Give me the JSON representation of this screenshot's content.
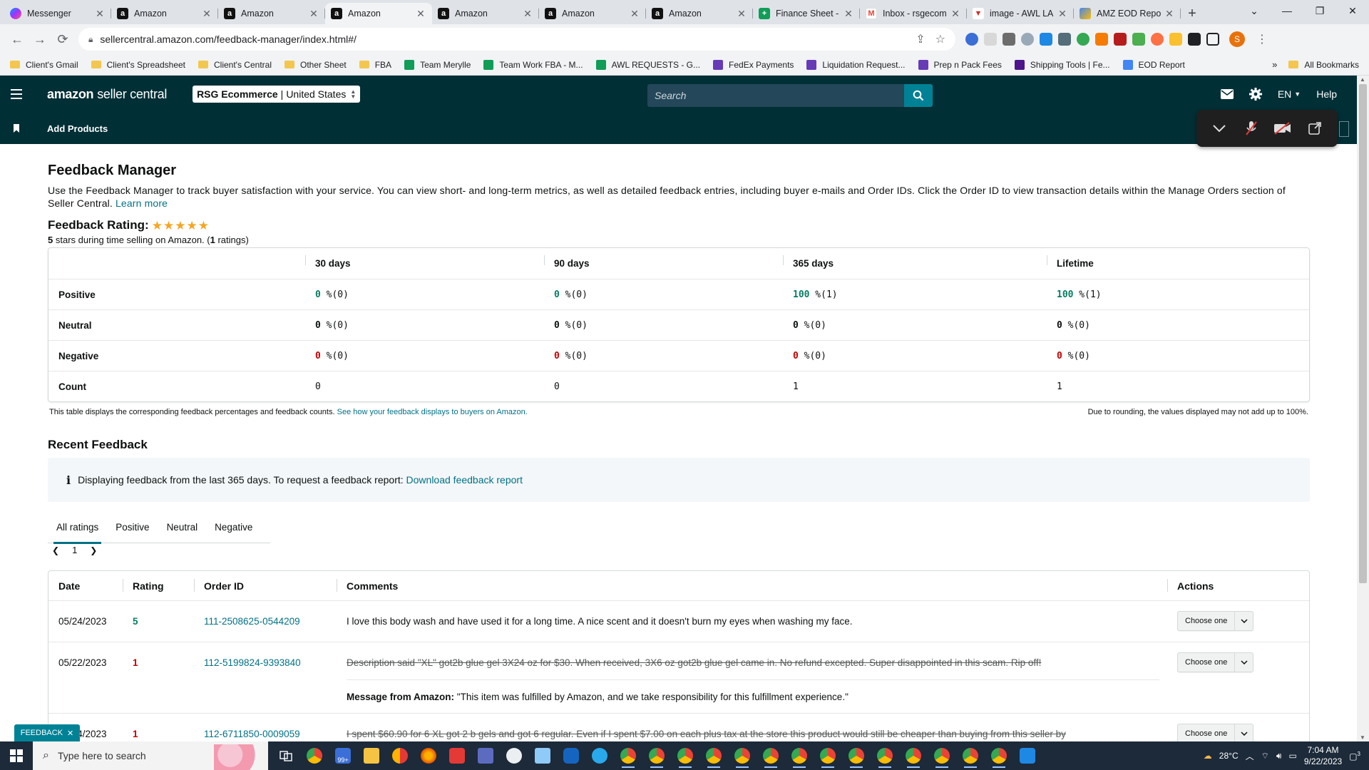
{
  "browser": {
    "tabs": [
      {
        "title": "Messenger",
        "fav": "msg"
      },
      {
        "title": "Amazon",
        "fav": "amz"
      },
      {
        "title": "Amazon",
        "fav": "amz"
      },
      {
        "title": "Amazon",
        "fav": "amz",
        "active": true
      },
      {
        "title": "Amazon",
        "fav": "amz"
      },
      {
        "title": "Amazon",
        "fav": "amz"
      },
      {
        "title": "Amazon",
        "fav": "amz"
      },
      {
        "title": "Finance Sheet -",
        "fav": "sheet"
      },
      {
        "title": "Inbox - rsgecom",
        "fav": "gmail"
      },
      {
        "title": "image - AWL LA",
        "fav": "img"
      },
      {
        "title": "AMZ EOD Repo",
        "fav": "eod"
      }
    ],
    "new_tab": "+",
    "url": "sellercentral.amazon.com/feedback-manager/index.html#/",
    "profile_initial": "S",
    "bookmarks": [
      {
        "label": "Client's Gmail",
        "kind": "folder"
      },
      {
        "label": "Client's Spreadsheet",
        "kind": "folder"
      },
      {
        "label": "Client's Central",
        "kind": "folder"
      },
      {
        "label": "Other Sheet",
        "kind": "folder"
      },
      {
        "label": "FBA",
        "kind": "folder"
      },
      {
        "label": "Team Merylle",
        "kind": "sheet"
      },
      {
        "label": "Team Work FBA - M...",
        "kind": "sheet"
      },
      {
        "label": "AWL REQUESTS - G...",
        "kind": "sheet"
      },
      {
        "label": "FedEx Payments",
        "kind": "form"
      },
      {
        "label": "Liquidation Request...",
        "kind": "form"
      },
      {
        "label": "Prep n Pack Fees",
        "kind": "form"
      },
      {
        "label": "Shipping Tools | Fe...",
        "kind": "fedex"
      },
      {
        "label": "EOD Report",
        "kind": "eod"
      }
    ],
    "bookmarks_more": "»",
    "all_bookmarks": "All Bookmarks"
  },
  "header": {
    "logo_amazon": "amazon",
    "logo_sc": "seller central",
    "store_name": "RSG Ecommerce",
    "store_region": "United States",
    "search_placeholder": "Search",
    "lang": "EN",
    "help": "Help",
    "sub_link": "Add Products"
  },
  "page": {
    "title": "Feedback Manager",
    "intro": "Use the Feedback Manager to track buyer satisfaction with your service. You can view short- and long-term metrics, as well as detailed feedback entries, including buyer e-mails and Order IDs. Click the Order ID to view transaction details within the Manage Orders section of Seller Central.",
    "learn_more": "Learn more",
    "rating_label": "Feedback Rating:",
    "stars": 5,
    "rating_stars_num": "5",
    "rating_sub_mid": " stars during time selling on Amazon. (",
    "rating_count": "1",
    "rating_sub_end": " ratings)"
  },
  "summary": {
    "columns": [
      "",
      "30 days",
      "90 days",
      "365 days",
      "Lifetime"
    ],
    "rows": [
      {
        "label": "Positive",
        "cells": [
          {
            "num": "0",
            "rest": " %(0)",
            "tone": "g"
          },
          {
            "num": "0",
            "rest": " %(0)",
            "tone": "g"
          },
          {
            "num": "100",
            "rest": " %(1)",
            "tone": "g"
          },
          {
            "num": "100",
            "rest": " %(1)",
            "tone": "g"
          }
        ]
      },
      {
        "label": "Neutral",
        "cells": [
          {
            "num": "0",
            "rest": " %(0)",
            "tone": "n"
          },
          {
            "num": "0",
            "rest": " %(0)",
            "tone": "n"
          },
          {
            "num": "0",
            "rest": " %(0)",
            "tone": "n"
          },
          {
            "num": "0",
            "rest": " %(0)",
            "tone": "n"
          }
        ]
      },
      {
        "label": "Negative",
        "cells": [
          {
            "num": "0",
            "rest": " %(0)",
            "tone": "r"
          },
          {
            "num": "0",
            "rest": " %(0)",
            "tone": "r"
          },
          {
            "num": "0",
            "rest": " %(0)",
            "tone": "r"
          },
          {
            "num": "0",
            "rest": " %(0)",
            "tone": "r"
          }
        ]
      },
      {
        "label": "Count",
        "cells": [
          {
            "num": "",
            "rest": "0",
            "tone": ""
          },
          {
            "num": "",
            "rest": "0",
            "tone": ""
          },
          {
            "num": "",
            "rest": "1",
            "tone": ""
          },
          {
            "num": "",
            "rest": "1",
            "tone": ""
          }
        ]
      }
    ],
    "note_left": "This table displays the corresponding feedback percentages and feedback counts.",
    "note_link": "See how your feedback displays to buyers on Amazon.",
    "note_right": "Due to rounding, the values displayed may not add up to 100%."
  },
  "recent": {
    "title": "Recent Feedback",
    "info_text": "Displaying feedback from the last 365 days. To request a feedback report:",
    "info_link": "Download feedback report",
    "tabs": [
      "All ratings",
      "Positive",
      "Neutral",
      "Negative"
    ],
    "active_tab": 0,
    "page": "1",
    "columns": [
      "Date",
      "Rating",
      "Order ID",
      "Comments",
      "Actions"
    ],
    "action_label": "Choose one",
    "rows": [
      {
        "date": "05/24/2023",
        "rating": "5",
        "order": "111-2508625-0544209",
        "comment": "I love this body wash and have used it for a long time. A nice scent and it doesn't burn my eyes when washing my face.",
        "struck": false
      },
      {
        "date": "05/22/2023",
        "rating": "1",
        "order": "112-5199824-9393840",
        "comment": "Description said \"XL\" got2b glue gel 3X24 oz for $30. When received, 3X6 oz got2b glue gel came in. No refund excepted. Super disappointed in this scam. Rip off!",
        "struck": true,
        "amz_label": "Message from Amazon:",
        "amz_msg": " \"This item was fulfilled by Amazon, and we take responsibility for this fulfillment experience.\""
      },
      {
        "date": "05/14/2023",
        "rating": "1",
        "order": "112-6711850-0009059",
        "comment": "I spent $60.90 for 6 XL got 2 b gels and got 6 regular. Even if I spent $7.00 on each plus tax at the store this product would still be cheaper than buying from this seller by",
        "struck": true
      }
    ]
  },
  "feedback_tab": "FEEDBACK",
  "taskbar": {
    "search_placeholder": "Type here to search",
    "weather": "28°C",
    "time": "7:04 AM",
    "date": "9/22/2023",
    "notif_count": "3",
    "mail_badge": "99+"
  },
  "colors": {
    "header_bg": "#002f36",
    "accent": "#008296",
    "link": "#007185",
    "positive": "#067d62",
    "negative": "#c40000",
    "star": "#f5a623"
  }
}
